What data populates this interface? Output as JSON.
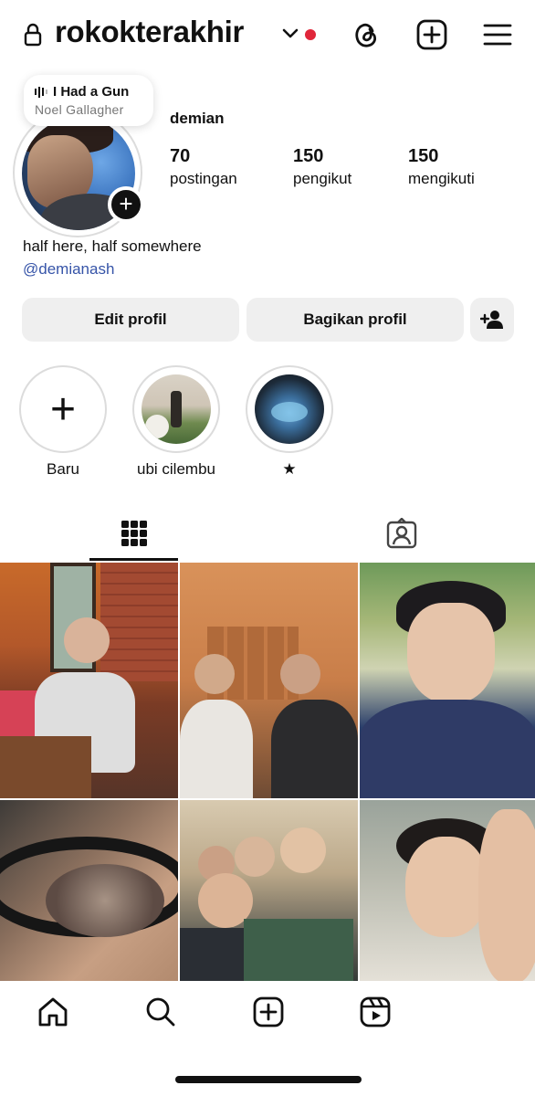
{
  "header": {
    "username": "rokokterakhir",
    "icons": [
      "lock-icon",
      "chevron-down-icon",
      "threads-icon",
      "add-post-icon",
      "menu-icon"
    ],
    "notification_dot_color": "#e0263a"
  },
  "music_note": {
    "title": "I Had a Gun",
    "artist": "Noel Gallagher"
  },
  "profile": {
    "display_name": "demian",
    "bio": "half here, half somewhere",
    "link": "@demianash",
    "stats": [
      {
        "value": "70",
        "label": "postingan"
      },
      {
        "value": "150",
        "label": "pengikut"
      },
      {
        "value": "150",
        "label": "mengikuti"
      }
    ]
  },
  "actions": {
    "edit": "Edit profil",
    "share": "Bagikan profil"
  },
  "highlights": [
    {
      "label": "Baru"
    },
    {
      "label": "ubi cilembu"
    },
    {
      "label": "★"
    }
  ],
  "tabs": [
    "grid-icon",
    "tagged-icon"
  ],
  "bottom_nav": [
    "home-icon",
    "search-icon",
    "create-icon",
    "reels-icon"
  ],
  "colors": {
    "link": "#3654a8",
    "button_bg": "#efefef"
  }
}
